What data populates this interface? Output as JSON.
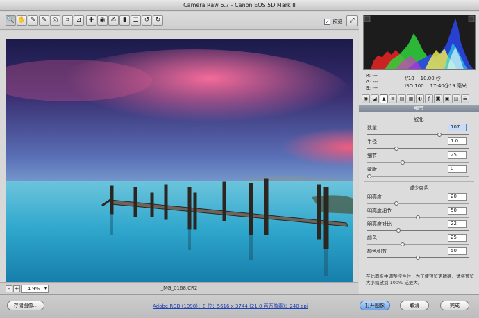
{
  "window": {
    "title": "Camera Raw 6.7 - Canon EOS 5D Mark II"
  },
  "toolbar": {
    "tools": [
      {
        "icon": "zoom-icon",
        "glyph": "🔍"
      },
      {
        "icon": "hand-icon",
        "glyph": "✋"
      },
      {
        "icon": "white-balance-icon",
        "glyph": "✎"
      },
      {
        "icon": "color-sampler-icon",
        "glyph": "✎"
      },
      {
        "icon": "targeted-adjustment-icon",
        "glyph": "◎"
      },
      {
        "icon": "crop-icon",
        "glyph": "⌗"
      },
      {
        "icon": "straighten-icon",
        "glyph": "⊿"
      },
      {
        "icon": "spot-removal-icon",
        "glyph": "✚"
      },
      {
        "icon": "red-eye-icon",
        "glyph": "◉"
      },
      {
        "icon": "adjustment-brush-icon",
        "glyph": "✍"
      },
      {
        "icon": "graduated-filter-icon",
        "glyph": "▮"
      },
      {
        "icon": "preferences-icon",
        "glyph": "☰"
      },
      {
        "icon": "rotate-left-icon",
        "glyph": "↺"
      },
      {
        "icon": "rotate-right-icon",
        "glyph": "↻"
      }
    ],
    "preview_label": "预览",
    "preview_checked": "✓"
  },
  "status": {
    "zoom_out": "-",
    "zoom_in": "+",
    "zoom": "14.9%",
    "filename": "_MG_0168.CR2"
  },
  "readout": {
    "r": "R:",
    "g": "G:",
    "b": "B:",
    "dash": "---",
    "aperture": "f/18",
    "shutter": "10.00 秒",
    "iso": "ISO 100",
    "lens": "17-40@19 毫米"
  },
  "panel": {
    "section_title": "细节",
    "sharpening_title": "锐化",
    "noise_title": "减少杂色",
    "sharpening": [
      {
        "label": "数量",
        "value": "107",
        "pos": 0.72
      },
      {
        "label": "半径",
        "value": "1.0",
        "pos": 0.28
      },
      {
        "label": "细节",
        "value": "25",
        "pos": 0.34
      },
      {
        "label": "蒙版",
        "value": "0",
        "pos": 0.0
      }
    ],
    "noise": [
      {
        "label": "明亮度",
        "value": "20",
        "pos": 0.28
      },
      {
        "label": "明亮度细节",
        "value": "50",
        "pos": 0.5
      },
      {
        "label": "明亮度对比",
        "value": "22",
        "pos": 0.3
      },
      {
        "label": "颜色",
        "value": "25",
        "pos": 0.34
      },
      {
        "label": "颜色细节",
        "value": "50",
        "pos": 0.5
      }
    ],
    "hint": "在此面板中调整控件时，为了使预览更精确，请将预览大小缩放到 100% 或更大。"
  },
  "bottom": {
    "save_label": "存储图像...",
    "workflow": "Adobe RGB (1998)；8 位；5616 x 3744 (21.0 百万像素)；240 ppi",
    "open_label": "打开图像",
    "cancel_label": "取消",
    "done_label": "完成"
  },
  "colors": {
    "accent": "#6fa3e6",
    "link": "#1f41b3"
  }
}
